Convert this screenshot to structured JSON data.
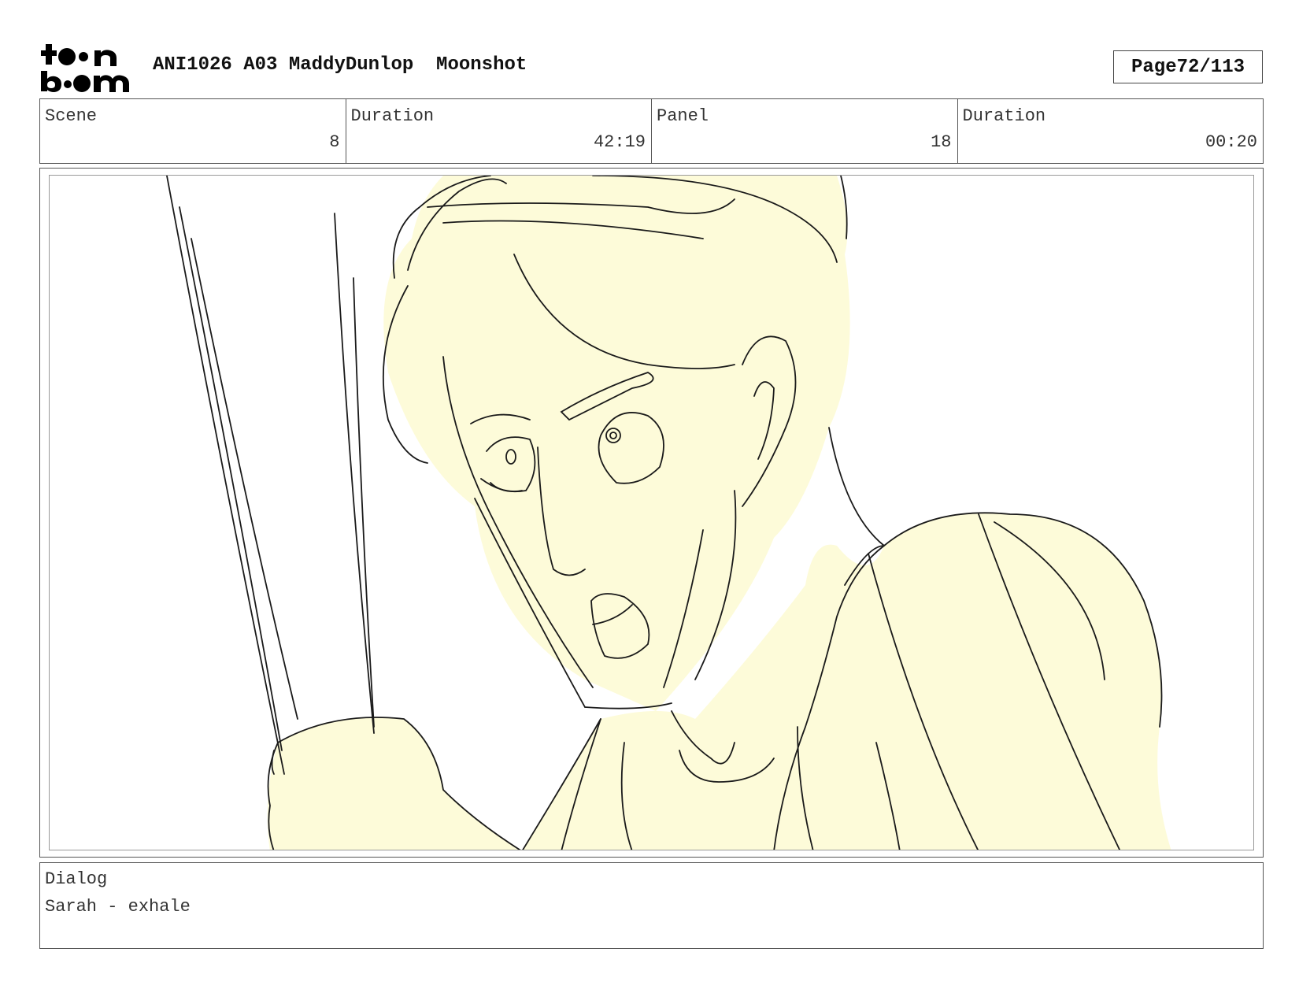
{
  "header": {
    "logo_text": "toonboom",
    "title": "ANI1026 A03 MaddyDunlop  Moonshot",
    "page_label": "Page",
    "page_value": "72/113"
  },
  "info": {
    "scene_label": "Scene",
    "scene_value": "8",
    "scene_duration_label": "Duration",
    "scene_duration_value": "42:19",
    "panel_label": "Panel",
    "panel_value": "18",
    "panel_duration_label": "Duration",
    "panel_duration_value": "00:20"
  },
  "panel": {
    "fill_color": "#fdfbd9",
    "line_color": "#1a1a1a"
  },
  "dialog": {
    "label": "Dialog",
    "text": "Sarah - exhale"
  }
}
